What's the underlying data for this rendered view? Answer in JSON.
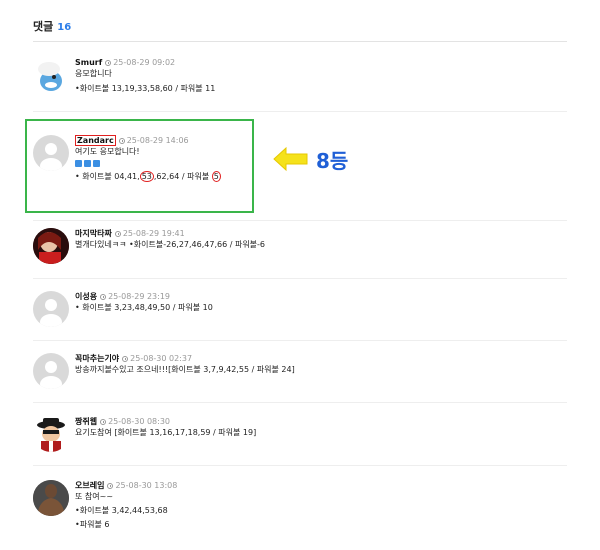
{
  "header": {
    "title": "댓글",
    "count": "16"
  },
  "comments": [
    {
      "author": "Smurf",
      "time": "25-08-29 09:02",
      "lines": [
        "응모합니다",
        "•화이트볼 13,19,33,58,60 / 파워볼 11"
      ]
    },
    {
      "author": "Zandarc",
      "time": "25-08-29 14:06",
      "lines": [
        "여기도 응모합니다!"
      ],
      "emoji": [
        "⬇️",
        "⬇️",
        "⬇️"
      ],
      "pick": {
        "prefix": "• 화이트볼 04,41,",
        "circled_a": "53",
        "mid": ",62,64 / 파워볼 ",
        "circled_b": "5"
      }
    },
    {
      "author": "마지막타짜",
      "time": "25-08-29 19:41",
      "lines": [
        "별개다있네ㅋㅋ •화이트볼-26,27,46,47,66 / 파워볼-6"
      ]
    },
    {
      "author": "이성용",
      "time": "25-08-29 23:19",
      "lines": [
        "• 화이트볼 3,23,48,49,50 / 파워볼 10"
      ]
    },
    {
      "author": "꼭마추는기야",
      "time": "25-08-30 02:37",
      "lines": [
        "방송까지볼수있고 조으네!!![화이트볼 3,7,9,42,55 / 파워볼 24]"
      ]
    },
    {
      "author": "짱쥐웹",
      "time": "25-08-30 08:30",
      "lines": [
        "요기도참여 [화이트볼 13,16,17,18,59 / 파워볼 19]"
      ]
    },
    {
      "author": "오브레임",
      "time": "25-08-30 13:08",
      "lines": [
        "또 참여~~",
        "•화이트볼 3,42,44,53,68",
        "•파워볼 6"
      ]
    }
  ],
  "annotation": {
    "rank": "8등"
  },
  "colors": {
    "accent": "#2b7de9",
    "highlight_border": "#3ab54a",
    "mark_red": "#e02020",
    "rank_blue": "#1f5fd6",
    "arrow_yellow": "#f5e21b"
  }
}
